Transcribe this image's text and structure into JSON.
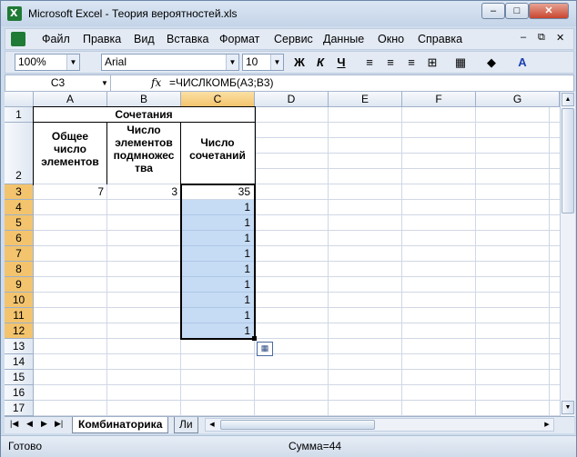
{
  "window": {
    "title": "Microsoft Excel - Теория вероятностей.xls"
  },
  "menu": [
    "Файл",
    "Правка",
    "Вид",
    "Вставка",
    "Формат",
    "Сервис",
    "Данные",
    "Окно",
    "Справка"
  ],
  "toolbar": {
    "zoom": "100%",
    "font": "Arial",
    "size": "10",
    "bold": "Ж",
    "italic": "К",
    "underline": "Ч"
  },
  "formula_bar": {
    "name_box": "C3",
    "fx": "fx",
    "formula": "=ЧИСЛКОМБ(A3;B3)"
  },
  "columns": [
    "A",
    "B",
    "C",
    "D",
    "E",
    "F",
    "G"
  ],
  "rows": [
    "1",
    "2",
    "3",
    "4",
    "5",
    "6",
    "7",
    "8",
    "9",
    "10",
    "11",
    "12",
    "13",
    "14",
    "15",
    "16",
    "17"
  ],
  "cells": {
    "title": "Сочетания",
    "hdr_a": "Общее число элементов",
    "hdr_b": "Число элементов подмножества",
    "hdr_b_lines": [
      "Число",
      "элементов",
      "подмножес",
      "тва"
    ],
    "hdr_a_lines": [
      "Общее",
      "число",
      "элементов"
    ],
    "hdr_c_lines": [
      "Число",
      "сочетаний"
    ],
    "a3": "7",
    "b3": "3",
    "c_values": [
      "35",
      "1",
      "1",
      "1",
      "1",
      "1",
      "1",
      "1",
      "1",
      "1"
    ]
  },
  "sheet_tabs": [
    "Комбинаторика",
    "Ли"
  ],
  "status": {
    "ready": "Готово",
    "sum": "Сумма=44"
  },
  "colors": {
    "selection": "#c6dcf5",
    "header_selected": "#f3c46d",
    "accent": "#1f7a35"
  }
}
